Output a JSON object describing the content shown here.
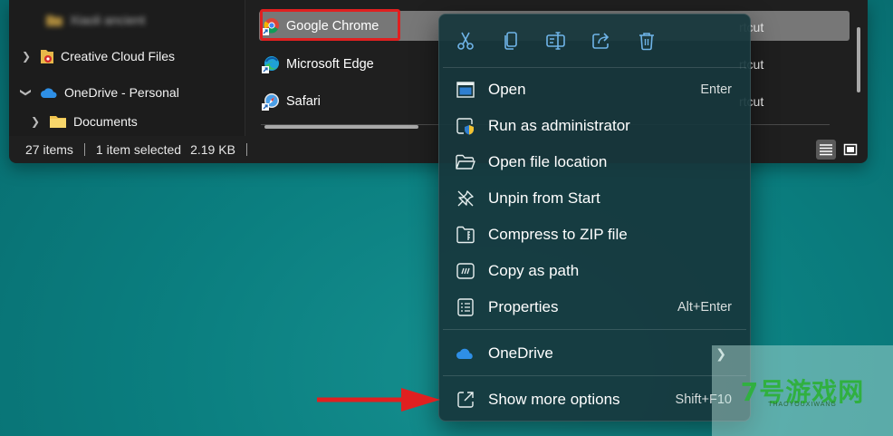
{
  "explorer": {
    "nav_items": [
      {
        "label": "Xiaoli ancient",
        "icon": "folder-icon",
        "blurred": true
      },
      {
        "label": "Creative Cloud Files",
        "icon": "creative-cloud-folder-icon"
      },
      {
        "label": "OneDrive - Personal",
        "icon": "onedrive-cloud-icon",
        "expanded": true
      },
      {
        "label": "Documents",
        "icon": "folder-icon"
      }
    ],
    "files": [
      {
        "name": "Google Chrome",
        "type": "Shortcut",
        "icon": "chrome-shortcut-icon",
        "selected": true
      },
      {
        "name": "Microsoft Edge",
        "type": "Shortcut",
        "icon": "edge-shortcut-icon"
      },
      {
        "name": "Safari",
        "type": "Shortcut",
        "icon": "safari-shortcut-icon"
      }
    ],
    "type_fragment": "rtcut",
    "status": {
      "item_count": "27 items",
      "selection": "1 item selected",
      "size": "2.19 KB"
    }
  },
  "context_menu": {
    "quick_actions": [
      {
        "name": "cut",
        "icon": "scissors-icon"
      },
      {
        "name": "copy",
        "icon": "copy-icon"
      },
      {
        "name": "rename",
        "icon": "rename-icon"
      },
      {
        "name": "share",
        "icon": "share-icon"
      },
      {
        "name": "delete",
        "icon": "trash-icon"
      }
    ],
    "items": [
      {
        "label": "Open",
        "accel": "Enter",
        "icon": "open-window-icon"
      },
      {
        "label": "Run as administrator",
        "accel": "",
        "icon": "shield-window-icon"
      },
      {
        "label": "Open file location",
        "accel": "",
        "icon": "folder-open-icon"
      },
      {
        "label": "Unpin from Start",
        "accel": "",
        "icon": "unpin-icon"
      },
      {
        "label": "Compress to ZIP file",
        "accel": "",
        "icon": "zip-icon"
      },
      {
        "label": "Copy as path",
        "accel": "",
        "icon": "copy-path-icon"
      },
      {
        "label": "Properties",
        "accel": "Alt+Enter",
        "icon": "properties-icon"
      }
    ],
    "onedrive": {
      "label": "OneDrive",
      "icon": "onedrive-cloud-icon"
    },
    "more": {
      "label": "Show more options",
      "accel": "Shift+F10",
      "icon": "show-more-icon"
    }
  },
  "watermark": {
    "text": "7号游戏网",
    "sub": "THAOYOUXIWANG"
  },
  "colors": {
    "desktop": "#0b7f80",
    "explorer_bg": "#1f1f1f",
    "selection": "#777777",
    "highlight": "#e02020",
    "menu_bg": "#17373c",
    "icon_blue": "#6fb4e8",
    "arrow_red": "#e02020"
  }
}
